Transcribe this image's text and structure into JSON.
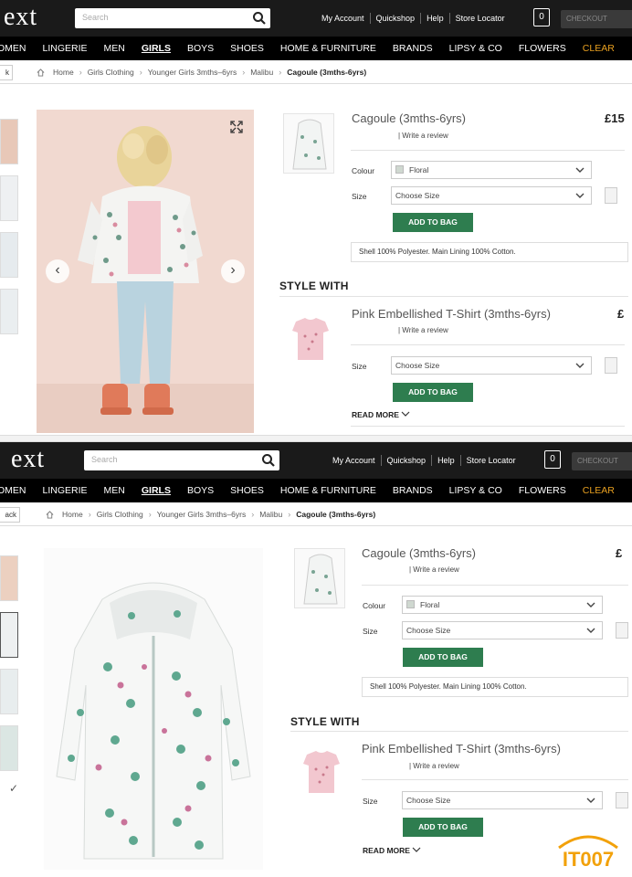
{
  "header": {
    "logo": "ext",
    "search_placeholder": "Search",
    "links": [
      "My Account",
      "Quickshop",
      "Help",
      "Store Locator"
    ],
    "bag_count": "0",
    "checkout_label": "CHECKOUT"
  },
  "nav": {
    "items": [
      "OMEN",
      "LINGERIE",
      "MEN",
      "GIRLS",
      "BOYS",
      "SHOES",
      "HOME & FURNITURE",
      "BRANDS",
      "LIPSY & CO",
      "FLOWERS",
      "CLEAR"
    ],
    "active": "GIRLS"
  },
  "breadcrumb": {
    "back_label": "k",
    "back_label_2": "ack",
    "items": [
      "Home",
      "Girls Clothing",
      "Younger Girls 3mths–6yrs",
      "Malibu"
    ],
    "current": "Cagoule (3mths-6yrs)"
  },
  "product": {
    "title": "Cagoule (3mths-6yrs)",
    "price_1": "£15",
    "price_2": "£",
    "review_link": "| Write a review",
    "colour_label": "Colour",
    "colour_value": "Floral",
    "size_label": "Size",
    "size_placeholder": "Choose Size",
    "add_to_bag": "ADD TO BAG",
    "composition": "Shell 100% Polyester. Main Lining 100% Cotton."
  },
  "style_with": {
    "heading": "STYLE WITH",
    "title": "Pink Embellished T-Shirt (3mths-6yrs)",
    "price": "£",
    "review_link": "| Write a review",
    "size_label": "Size",
    "size_placeholder": "Choose Size",
    "add_to_bag": "ADD TO BAG",
    "read_more": "READ MORE"
  },
  "watermark": "IT007",
  "colors": {
    "header_bg": "#1a1a1a",
    "nav_bg": "#000000",
    "add_to_bag": "#2e7d4f",
    "clearance": "#e8a020",
    "photo_bg": "#f1d9d0",
    "watermark_orange": "#f2a10a"
  }
}
